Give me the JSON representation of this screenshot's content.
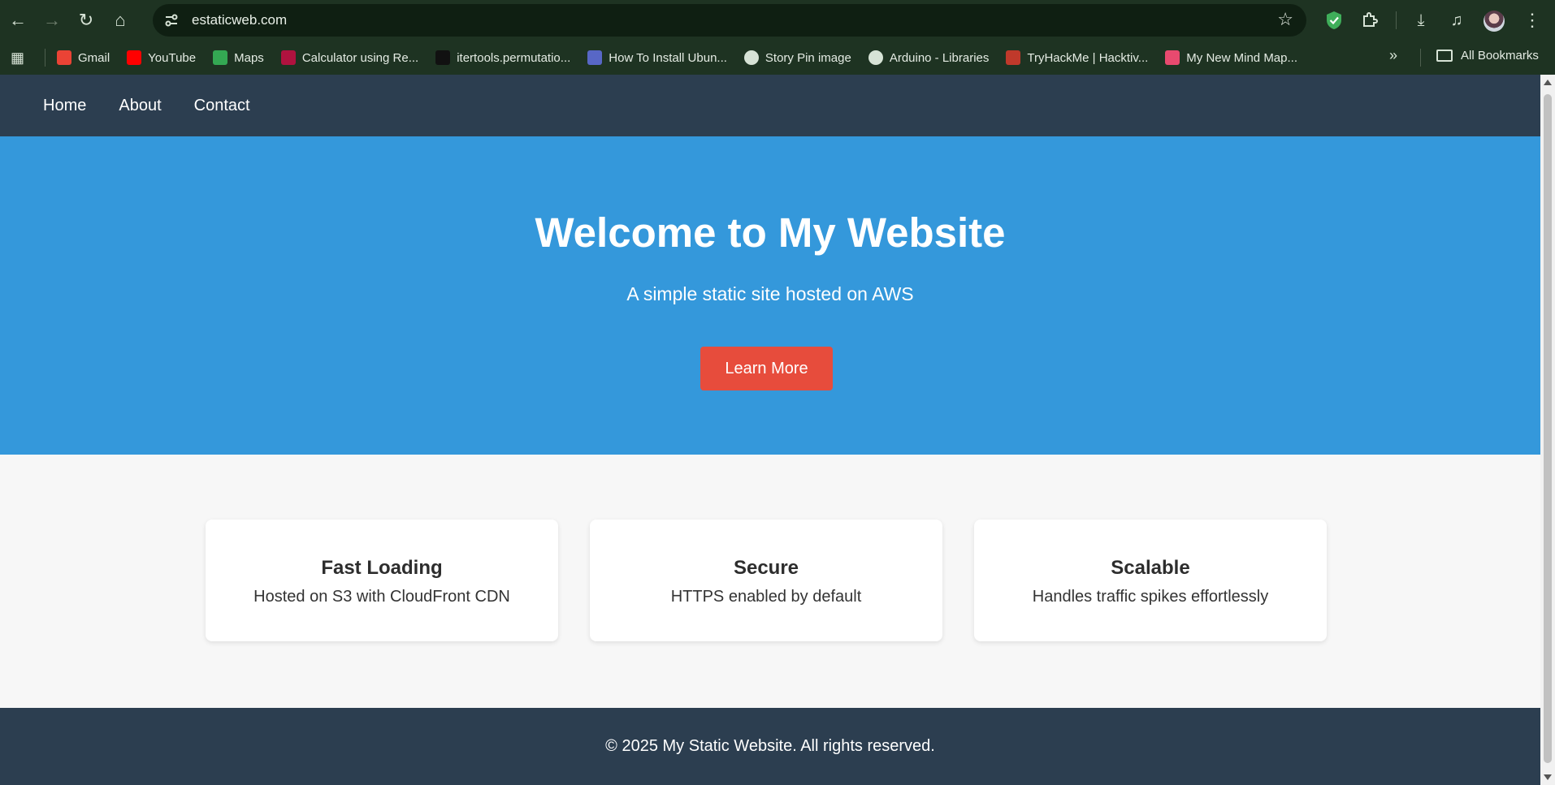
{
  "browser": {
    "url": "estaticweb.com",
    "bookmarks": [
      {
        "label": "Gmail",
        "icon": "gmail-icon",
        "color": "#ea4335"
      },
      {
        "label": "YouTube",
        "icon": "youtube-icon",
        "color": "#ff0000"
      },
      {
        "label": "Maps",
        "icon": "maps-icon",
        "color": "#34a853"
      },
      {
        "label": "Calculator using Re...",
        "icon": "sf-icon",
        "color": "#b0123f"
      },
      {
        "label": "itertools.permutatio...",
        "icon": "hackerrank-icon",
        "color": "#111111"
      },
      {
        "label": "How To Install Ubun...",
        "icon": "ubuntu-icon",
        "color": "#5867c6"
      },
      {
        "label": "Story Pin image",
        "icon": "globe-icon",
        "color": "#cccccc"
      },
      {
        "label": "Arduino - Libraries",
        "icon": "globe-icon",
        "color": "#cccccc"
      },
      {
        "label": "TryHackMe | Hacktiv...",
        "icon": "tryhackme-icon",
        "color": "#c0392b"
      },
      {
        "label": "My New Mind Map...",
        "icon": "mindmap-icon",
        "color": "#e84a6f"
      }
    ],
    "all_bookmarks": "All Bookmarks"
  },
  "site": {
    "nav": [
      "Home",
      "About",
      "Contact"
    ],
    "hero": {
      "title": "Welcome to My Website",
      "subtitle": "A simple static site hosted on AWS",
      "button": "Learn More"
    },
    "features": [
      {
        "title": "Fast Loading",
        "text": "Hosted on S3 with CloudFront CDN"
      },
      {
        "title": "Secure",
        "text": "HTTPS enabled by default"
      },
      {
        "title": "Scalable",
        "text": "Handles traffic spikes effortlessly"
      }
    ],
    "footer": "© 2025 My Static Website. All rights reserved."
  },
  "colors": {
    "nav_bg": "#2c3e50",
    "hero_bg": "#3498db",
    "button_bg": "#e74c3c",
    "page_bg": "#f7f7f7"
  }
}
